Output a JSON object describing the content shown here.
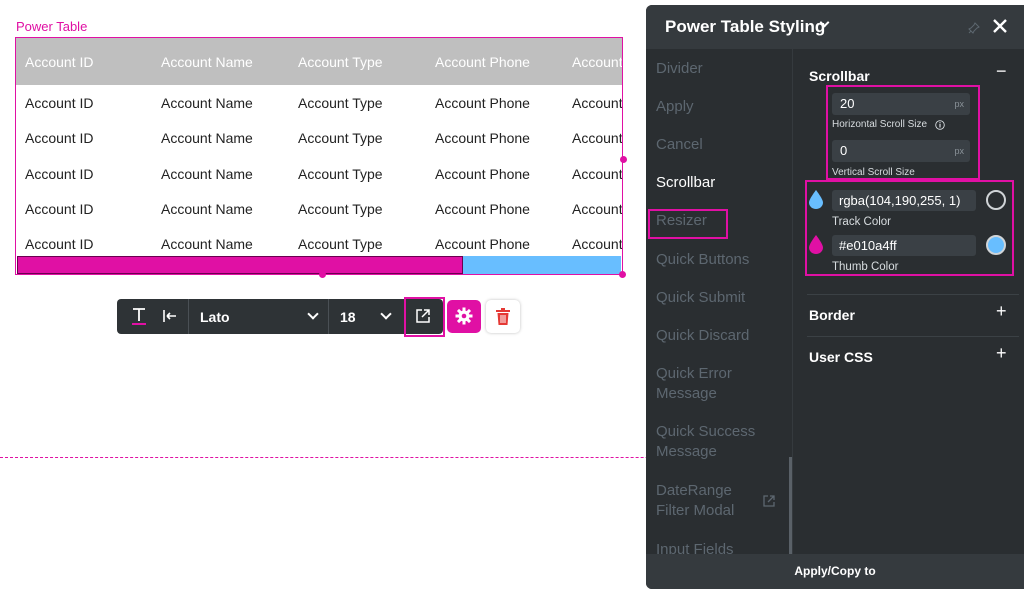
{
  "canvas": {
    "widget_label": "Power Table",
    "table": {
      "headers": [
        "Account ID",
        "Account Name",
        "Account Type",
        "Account Phone",
        "Account"
      ],
      "rows": [
        [
          "Account ID",
          "Account Name",
          "Account Type",
          "Account Phone",
          "Account"
        ],
        [
          "Account ID",
          "Account Name",
          "Account Type",
          "Account Phone",
          "Account"
        ],
        [
          "Account ID",
          "Account Name",
          "Account Type",
          "Account Phone",
          "Account"
        ],
        [
          "Account ID",
          "Account Name",
          "Account Type",
          "Account Phone",
          "Account"
        ],
        [
          "Account ID",
          "Account Name",
          "Account Type",
          "Account Phone",
          "Account"
        ]
      ]
    },
    "scrollbar_colors": {
      "thumb": "#e010a4",
      "track": "#68beff"
    }
  },
  "toolbar": {
    "text_icon": "text-format-icon",
    "indent_icon": "indent-icon",
    "font_family": "Lato",
    "font_size": "18",
    "external_icon": "external-link-icon",
    "gear_icon": "gear-icon",
    "trash_icon": "trash-icon"
  },
  "panel": {
    "title": "Power Table Styling",
    "nav_items": [
      "Divider",
      "Apply",
      "Cancel",
      "Scrollbar",
      "Resizer",
      "Quick Buttons",
      "Quick Submit",
      "Quick Discard",
      "Quick Error Message",
      "Quick Success Message",
      "DateRange Filter Modal",
      "Input Fields"
    ],
    "active_nav": "Scrollbar",
    "scrollbar_section": {
      "title": "Scrollbar",
      "toggle": "−",
      "horizontal_size": {
        "value": "20",
        "unit": "px",
        "label": "Horizontal Scroll Size"
      },
      "vertical_size": {
        "value": "0",
        "unit": "px",
        "label": "Vertical Scroll Size"
      },
      "track_color": {
        "value": "rgba(104,190,255, 1)",
        "label": "Track Color"
      },
      "thumb_color": {
        "value": "#e010a4ff",
        "label": "Thumb Color"
      }
    },
    "border_section": {
      "title": "Border",
      "toggle": "+"
    },
    "user_css_section": {
      "title": "User CSS",
      "toggle": "+"
    },
    "footer": "Apply/Copy to"
  }
}
